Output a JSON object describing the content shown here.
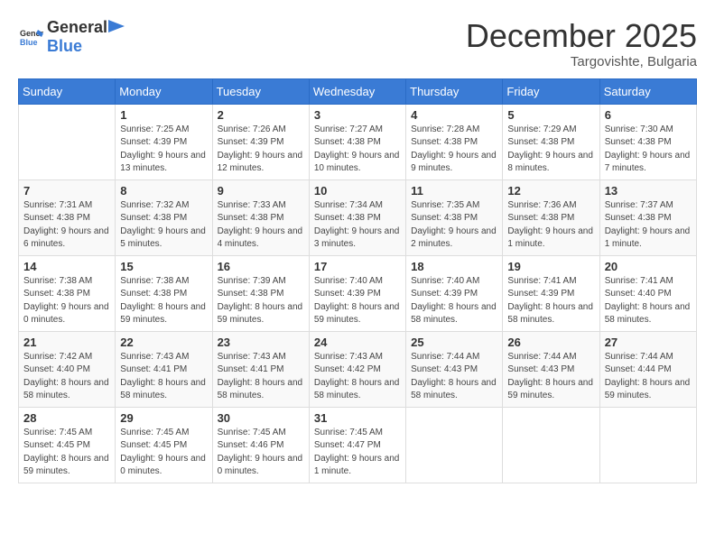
{
  "header": {
    "logo_general": "General",
    "logo_blue": "Blue",
    "month": "December 2025",
    "location": "Targovishte, Bulgaria"
  },
  "weekdays": [
    "Sunday",
    "Monday",
    "Tuesday",
    "Wednesday",
    "Thursday",
    "Friday",
    "Saturday"
  ],
  "weeks": [
    [
      {
        "day": "",
        "sunrise": "",
        "sunset": "",
        "daylight": ""
      },
      {
        "day": "1",
        "sunrise": "Sunrise: 7:25 AM",
        "sunset": "Sunset: 4:39 PM",
        "daylight": "Daylight: 9 hours and 13 minutes."
      },
      {
        "day": "2",
        "sunrise": "Sunrise: 7:26 AM",
        "sunset": "Sunset: 4:39 PM",
        "daylight": "Daylight: 9 hours and 12 minutes."
      },
      {
        "day": "3",
        "sunrise": "Sunrise: 7:27 AM",
        "sunset": "Sunset: 4:38 PM",
        "daylight": "Daylight: 9 hours and 10 minutes."
      },
      {
        "day": "4",
        "sunrise": "Sunrise: 7:28 AM",
        "sunset": "Sunset: 4:38 PM",
        "daylight": "Daylight: 9 hours and 9 minutes."
      },
      {
        "day": "5",
        "sunrise": "Sunrise: 7:29 AM",
        "sunset": "Sunset: 4:38 PM",
        "daylight": "Daylight: 9 hours and 8 minutes."
      },
      {
        "day": "6",
        "sunrise": "Sunrise: 7:30 AM",
        "sunset": "Sunset: 4:38 PM",
        "daylight": "Daylight: 9 hours and 7 minutes."
      }
    ],
    [
      {
        "day": "7",
        "sunrise": "Sunrise: 7:31 AM",
        "sunset": "Sunset: 4:38 PM",
        "daylight": "Daylight: 9 hours and 6 minutes."
      },
      {
        "day": "8",
        "sunrise": "Sunrise: 7:32 AM",
        "sunset": "Sunset: 4:38 PM",
        "daylight": "Daylight: 9 hours and 5 minutes."
      },
      {
        "day": "9",
        "sunrise": "Sunrise: 7:33 AM",
        "sunset": "Sunset: 4:38 PM",
        "daylight": "Daylight: 9 hours and 4 minutes."
      },
      {
        "day": "10",
        "sunrise": "Sunrise: 7:34 AM",
        "sunset": "Sunset: 4:38 PM",
        "daylight": "Daylight: 9 hours and 3 minutes."
      },
      {
        "day": "11",
        "sunrise": "Sunrise: 7:35 AM",
        "sunset": "Sunset: 4:38 PM",
        "daylight": "Daylight: 9 hours and 2 minutes."
      },
      {
        "day": "12",
        "sunrise": "Sunrise: 7:36 AM",
        "sunset": "Sunset: 4:38 PM",
        "daylight": "Daylight: 9 hours and 1 minute."
      },
      {
        "day": "13",
        "sunrise": "Sunrise: 7:37 AM",
        "sunset": "Sunset: 4:38 PM",
        "daylight": "Daylight: 9 hours and 1 minute."
      }
    ],
    [
      {
        "day": "14",
        "sunrise": "Sunrise: 7:38 AM",
        "sunset": "Sunset: 4:38 PM",
        "daylight": "Daylight: 9 hours and 0 minutes."
      },
      {
        "day": "15",
        "sunrise": "Sunrise: 7:38 AM",
        "sunset": "Sunset: 4:38 PM",
        "daylight": "Daylight: 8 hours and 59 minutes."
      },
      {
        "day": "16",
        "sunrise": "Sunrise: 7:39 AM",
        "sunset": "Sunset: 4:38 PM",
        "daylight": "Daylight: 8 hours and 59 minutes."
      },
      {
        "day": "17",
        "sunrise": "Sunrise: 7:40 AM",
        "sunset": "Sunset: 4:39 PM",
        "daylight": "Daylight: 8 hours and 59 minutes."
      },
      {
        "day": "18",
        "sunrise": "Sunrise: 7:40 AM",
        "sunset": "Sunset: 4:39 PM",
        "daylight": "Daylight: 8 hours and 58 minutes."
      },
      {
        "day": "19",
        "sunrise": "Sunrise: 7:41 AM",
        "sunset": "Sunset: 4:39 PM",
        "daylight": "Daylight: 8 hours and 58 minutes."
      },
      {
        "day": "20",
        "sunrise": "Sunrise: 7:41 AM",
        "sunset": "Sunset: 4:40 PM",
        "daylight": "Daylight: 8 hours and 58 minutes."
      }
    ],
    [
      {
        "day": "21",
        "sunrise": "Sunrise: 7:42 AM",
        "sunset": "Sunset: 4:40 PM",
        "daylight": "Daylight: 8 hours and 58 minutes."
      },
      {
        "day": "22",
        "sunrise": "Sunrise: 7:43 AM",
        "sunset": "Sunset: 4:41 PM",
        "daylight": "Daylight: 8 hours and 58 minutes."
      },
      {
        "day": "23",
        "sunrise": "Sunrise: 7:43 AM",
        "sunset": "Sunset: 4:41 PM",
        "daylight": "Daylight: 8 hours and 58 minutes."
      },
      {
        "day": "24",
        "sunrise": "Sunrise: 7:43 AM",
        "sunset": "Sunset: 4:42 PM",
        "daylight": "Daylight: 8 hours and 58 minutes."
      },
      {
        "day": "25",
        "sunrise": "Sunrise: 7:44 AM",
        "sunset": "Sunset: 4:43 PM",
        "daylight": "Daylight: 8 hours and 58 minutes."
      },
      {
        "day": "26",
        "sunrise": "Sunrise: 7:44 AM",
        "sunset": "Sunset: 4:43 PM",
        "daylight": "Daylight: 8 hours and 59 minutes."
      },
      {
        "day": "27",
        "sunrise": "Sunrise: 7:44 AM",
        "sunset": "Sunset: 4:44 PM",
        "daylight": "Daylight: 8 hours and 59 minutes."
      }
    ],
    [
      {
        "day": "28",
        "sunrise": "Sunrise: 7:45 AM",
        "sunset": "Sunset: 4:45 PM",
        "daylight": "Daylight: 8 hours and 59 minutes."
      },
      {
        "day": "29",
        "sunrise": "Sunrise: 7:45 AM",
        "sunset": "Sunset: 4:45 PM",
        "daylight": "Daylight: 9 hours and 0 minutes."
      },
      {
        "day": "30",
        "sunrise": "Sunrise: 7:45 AM",
        "sunset": "Sunset: 4:46 PM",
        "daylight": "Daylight: 9 hours and 0 minutes."
      },
      {
        "day": "31",
        "sunrise": "Sunrise: 7:45 AM",
        "sunset": "Sunset: 4:47 PM",
        "daylight": "Daylight: 9 hours and 1 minute."
      },
      {
        "day": "",
        "sunrise": "",
        "sunset": "",
        "daylight": ""
      },
      {
        "day": "",
        "sunrise": "",
        "sunset": "",
        "daylight": ""
      },
      {
        "day": "",
        "sunrise": "",
        "sunset": "",
        "daylight": ""
      }
    ]
  ]
}
